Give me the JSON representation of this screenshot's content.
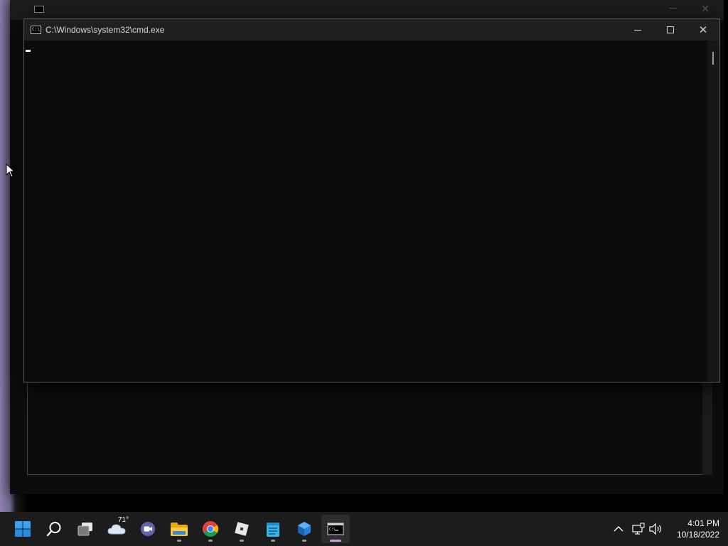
{
  "window": {
    "title": "C:\\Windows\\system32\\cmd.exe"
  },
  "taskbar": {
    "weather_temp": "71°",
    "items": [
      {
        "name": "start-button",
        "icon": "windows-logo-icon"
      },
      {
        "name": "search-button",
        "icon": "search-icon"
      },
      {
        "name": "task-view-button",
        "icon": "task-view-icon"
      },
      {
        "name": "widgets-button",
        "icon": "weather-cloud-icon"
      },
      {
        "name": "teams-chat-button",
        "icon": "teams-chat-icon"
      },
      {
        "name": "file-explorer-button",
        "icon": "folder-icon"
      },
      {
        "name": "chrome-button",
        "icon": "chrome-icon"
      },
      {
        "name": "roblox-button",
        "icon": "roblox-icon"
      },
      {
        "name": "notepad-button",
        "icon": "notepad-icon"
      },
      {
        "name": "app-button",
        "icon": "blue-cube-icon"
      },
      {
        "name": "cmd-taskbar-button",
        "icon": "terminal-icon",
        "active": true
      }
    ]
  },
  "clock": {
    "time": "4:01 PM",
    "date": "10/18/2022"
  },
  "colors": {
    "taskbar_bg": "#1c1c1c",
    "console_bg": "#0c0c0c",
    "accent": "#c9a0dc"
  }
}
